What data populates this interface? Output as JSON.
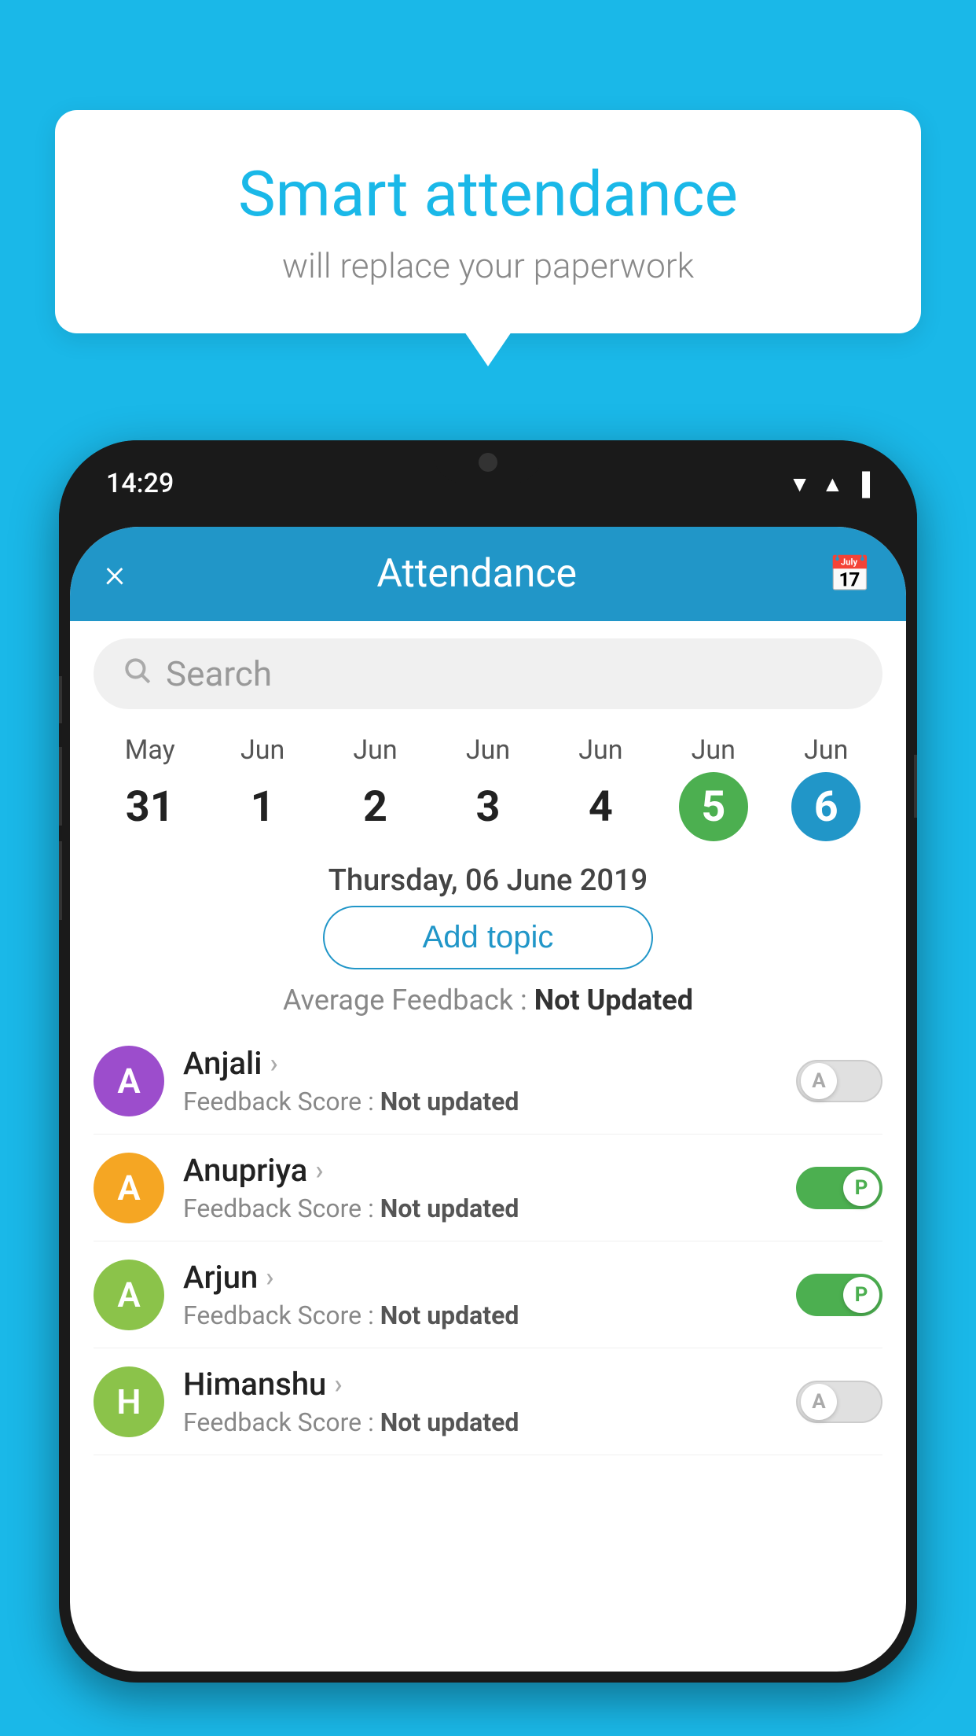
{
  "background_color": "#1ab8e8",
  "bubble": {
    "title": "Smart attendance",
    "subtitle": "will replace your paperwork"
  },
  "phone": {
    "status_bar": {
      "time": "14:29"
    },
    "header": {
      "title": "Attendance",
      "close_icon": "×",
      "calendar_icon": "📅"
    },
    "search": {
      "placeholder": "Search"
    },
    "dates": [
      {
        "month": "May",
        "day": "31",
        "style": "normal"
      },
      {
        "month": "Jun",
        "day": "1",
        "style": "normal"
      },
      {
        "month": "Jun",
        "day": "2",
        "style": "normal"
      },
      {
        "month": "Jun",
        "day": "3",
        "style": "normal"
      },
      {
        "month": "Jun",
        "day": "4",
        "style": "normal"
      },
      {
        "month": "Jun",
        "day": "5",
        "style": "green"
      },
      {
        "month": "Jun",
        "day": "6",
        "style": "blue"
      }
    ],
    "selected_date": "Thursday, 06 June 2019",
    "add_topic_label": "Add topic",
    "avg_feedback_label": "Average Feedback : ",
    "avg_feedback_value": "Not Updated",
    "students": [
      {
        "name": "Anjali",
        "avatar_letter": "A",
        "avatar_color": "#9c4dcc",
        "feedback_label": "Feedback Score : ",
        "feedback_value": "Not updated",
        "toggle_state": "off",
        "toggle_label": "A"
      },
      {
        "name": "Anupriya",
        "avatar_letter": "A",
        "avatar_color": "#f5a623",
        "feedback_label": "Feedback Score : ",
        "feedback_value": "Not updated",
        "toggle_state": "on",
        "toggle_label": "P"
      },
      {
        "name": "Arjun",
        "avatar_letter": "A",
        "avatar_color": "#8bc34a",
        "feedback_label": "Feedback Score : ",
        "feedback_value": "Not updated",
        "toggle_state": "on",
        "toggle_label": "P"
      },
      {
        "name": "Himanshu",
        "avatar_letter": "H",
        "avatar_color": "#8bc34a",
        "feedback_label": "Feedback Score : ",
        "feedback_value": "Not updated",
        "toggle_state": "off",
        "toggle_label": "A"
      }
    ]
  }
}
